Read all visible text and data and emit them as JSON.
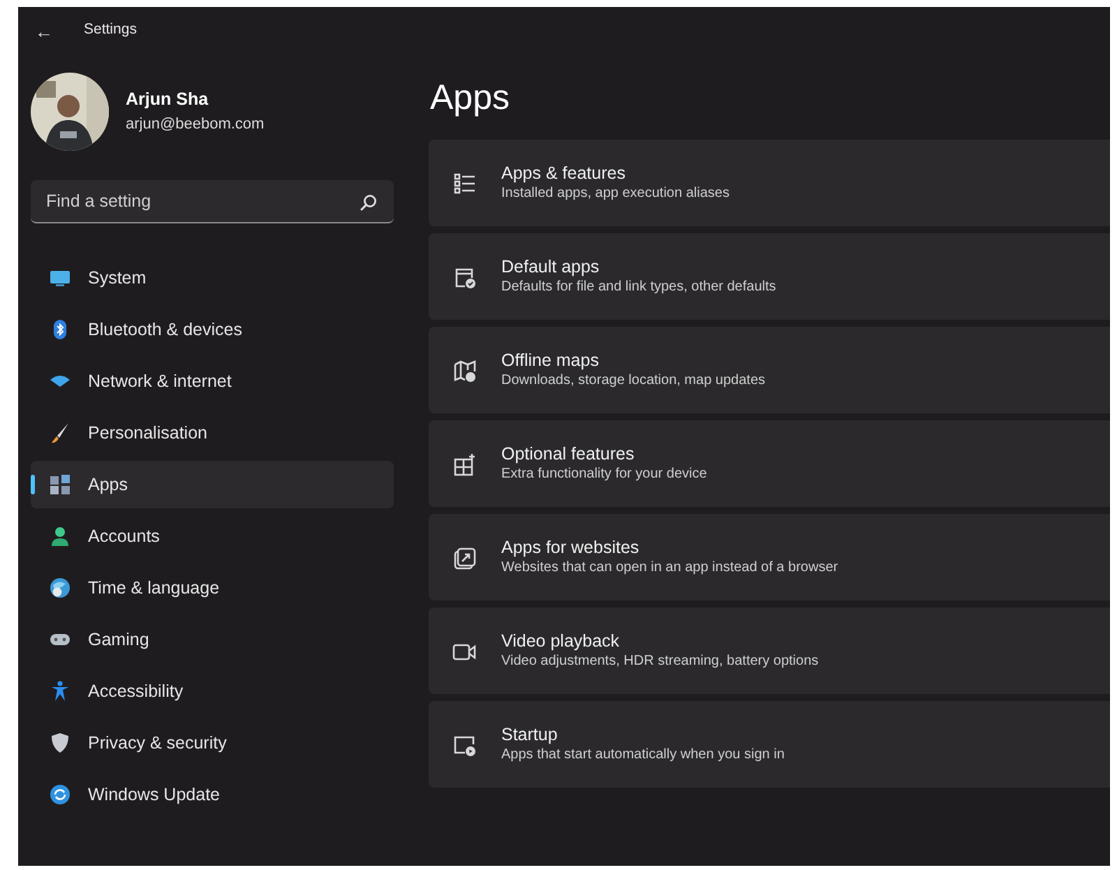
{
  "window": {
    "title": "Settings",
    "back": "←"
  },
  "account": {
    "name": "Arjun Sha",
    "email": "arjun@beebom.com"
  },
  "search": {
    "placeholder": "Find a setting"
  },
  "sidebar": {
    "items": [
      {
        "label": "System",
        "selected": false
      },
      {
        "label": "Bluetooth & devices",
        "selected": false
      },
      {
        "label": "Network & internet",
        "selected": false
      },
      {
        "label": "Personalisation",
        "selected": false
      },
      {
        "label": "Apps",
        "selected": true
      },
      {
        "label": "Accounts",
        "selected": false
      },
      {
        "label": "Time & language",
        "selected": false
      },
      {
        "label": "Gaming",
        "selected": false
      },
      {
        "label": "Accessibility",
        "selected": false
      },
      {
        "label": "Privacy & security",
        "selected": false
      },
      {
        "label": "Windows Update",
        "selected": false
      }
    ]
  },
  "page": {
    "title": "Apps",
    "cards": [
      {
        "title": "Apps & features",
        "subtitle": "Installed apps, app execution aliases"
      },
      {
        "title": "Default apps",
        "subtitle": "Defaults for file and link types, other defaults"
      },
      {
        "title": "Offline maps",
        "subtitle": "Downloads, storage location, map updates"
      },
      {
        "title": "Optional features",
        "subtitle": "Extra functionality for your device"
      },
      {
        "title": "Apps for websites",
        "subtitle": "Websites that can open in an app instead of a browser"
      },
      {
        "title": "Video playback",
        "subtitle": "Video adjustments, HDR streaming, battery options"
      },
      {
        "title": "Startup",
        "subtitle": "Apps that start automatically when you sign in"
      }
    ]
  }
}
